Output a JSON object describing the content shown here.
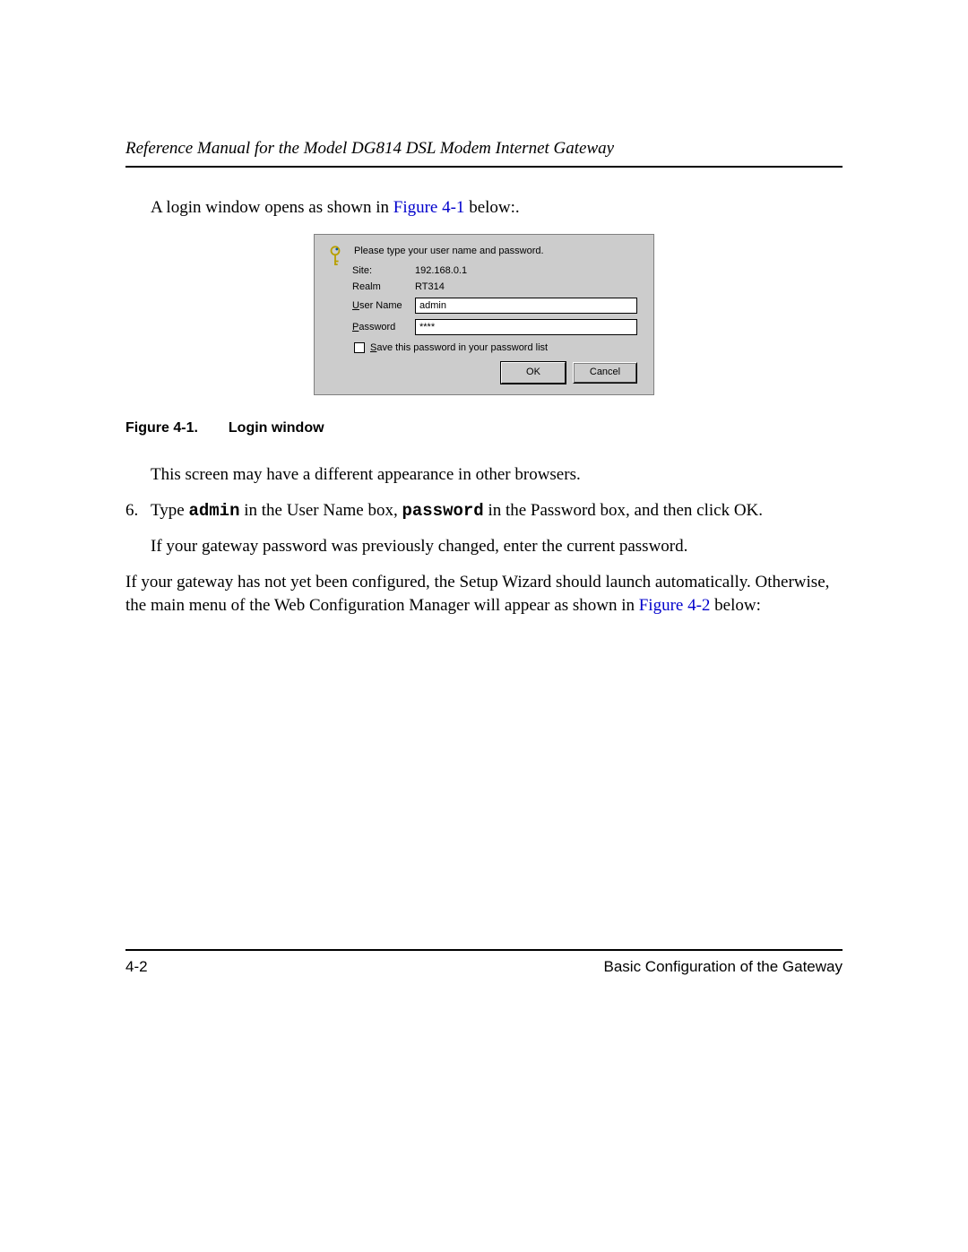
{
  "header": {
    "title": "Reference Manual for the Model DG814 DSL Modem Internet Gateway"
  },
  "body": {
    "intro_pre": "A login window opens as shown in ",
    "intro_link": "Figure 4-1",
    "intro_post": " below:.",
    "caption_num": "Figure 4-1.",
    "caption_text": "Login window",
    "para1": "This screen may have a different appearance in other browsers.",
    "step6": {
      "marker": "6.",
      "t1": "Type ",
      "admin": "admin",
      "t2": " in the User Name box, ",
      "password": "password",
      "t3": "  in the Password box, and then click OK.",
      "sub": "If your gateway password was previously changed, enter the current password."
    },
    "para2_pre": "If your gateway has not yet been configured, the Setup Wizard should launch automatically. Otherwise, the main menu of the Web Configuration Manager will appear as shown in ",
    "para2_link": "Figure 4-2",
    "para2_post": " below:"
  },
  "dialog": {
    "instruction": "Please type your user name and password.",
    "site_label": "Site:",
    "site_value": "192.168.0.1",
    "realm_label": "Realm",
    "realm_value": "RT314",
    "user_label": "User Name",
    "user_value": "admin",
    "pass_label": "Password",
    "pass_value": "****",
    "save_label": "Save this password in your password list",
    "ok": "OK",
    "cancel": "Cancel"
  },
  "footer": {
    "page": "4-2",
    "section": "Basic Configuration of the Gateway"
  }
}
